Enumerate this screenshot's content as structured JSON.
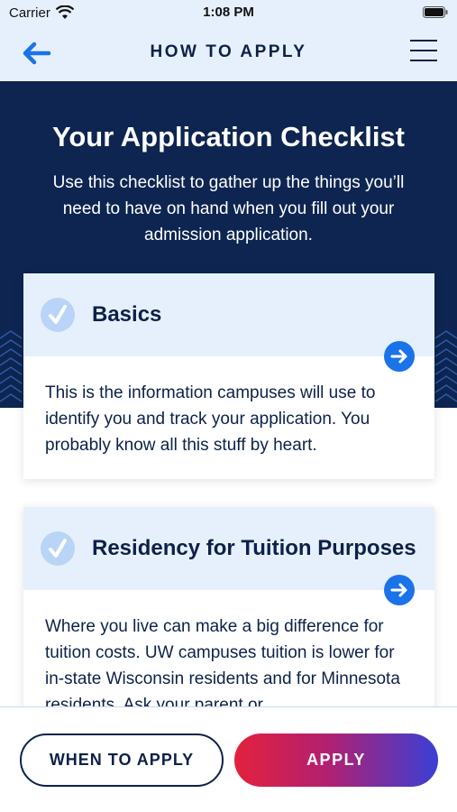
{
  "status_bar": {
    "carrier": "Carrier",
    "time": "1:08 PM"
  },
  "nav": {
    "title": "HOW TO APPLY",
    "back_icon": "back-arrow-icon",
    "menu_icon": "hamburger-menu-icon"
  },
  "hero": {
    "title": "Your Application Checklist",
    "text": "Use this checklist to gather up the things you’ll need to have on hand when you fill out your admission application."
  },
  "cards": [
    {
      "title": "Basics",
      "body": "This is the information campuses will use to identify you and track your application. You probably know all this stuff by heart."
    },
    {
      "title": "Residency for Tuition Purposes",
      "body": "Where you live can make a big difference for tuition costs. UW campuses tuition is lower for in-state Wisconsin residents and for Minnesota residents. Ask your parent or"
    }
  ],
  "bottom": {
    "when_label": "WHEN TO APPLY",
    "apply_label": "APPLY"
  },
  "colors": {
    "navy": "#0d2550",
    "light_blue": "#e6f0fc",
    "accent_blue": "#1a73e8",
    "apply_gradient_start": "#e3213e",
    "apply_gradient_end": "#3a3fd6"
  }
}
